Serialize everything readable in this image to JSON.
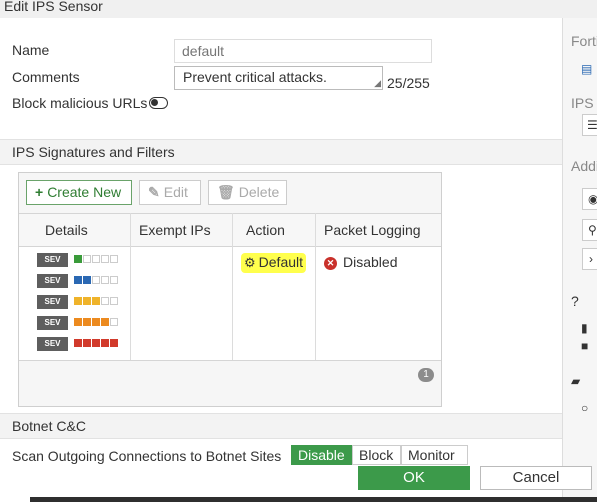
{
  "window": {
    "title": "Edit IPS Sensor"
  },
  "form": {
    "name_label": "Name",
    "name_placeholder": "default",
    "comments_label": "Comments",
    "comments_value": "Prevent critical attacks.",
    "comments_counter": "25/255",
    "block_urls_label": "Block malicious URLs",
    "block_urls_enabled": false
  },
  "signatures": {
    "section_title": "IPS Signatures and Filters",
    "toolbar": {
      "create_label": "Create New",
      "edit_label": "Edit",
      "delete_label": "Delete"
    },
    "columns": [
      "Details",
      "Exempt IPs",
      "Action",
      "Packet Logging"
    ],
    "row": {
      "severity_badge": "SEV",
      "severity_levels": [
        1,
        2,
        3,
        4,
        5
      ],
      "severity_colors": [
        "#3a9b3a",
        "#2a68b3",
        "#efb32a",
        "#ec8a1f",
        "#d13a2b"
      ],
      "exempt_ips": "",
      "action": "Default",
      "packet_logging": "Disabled"
    },
    "page_count": "1"
  },
  "botnet": {
    "section_title": "Botnet C&C",
    "scan_label": "Scan Outgoing Connections to Botnet Sites",
    "options": [
      "Disable",
      "Block",
      "Monitor"
    ],
    "selected": "Disable"
  },
  "footer": {
    "ok_label": "OK",
    "cancel_label": "Cancel"
  },
  "right_panel": {
    "fortiview_text": "Forti",
    "ips_text": "IPS S",
    "additional_text": "Addi"
  }
}
